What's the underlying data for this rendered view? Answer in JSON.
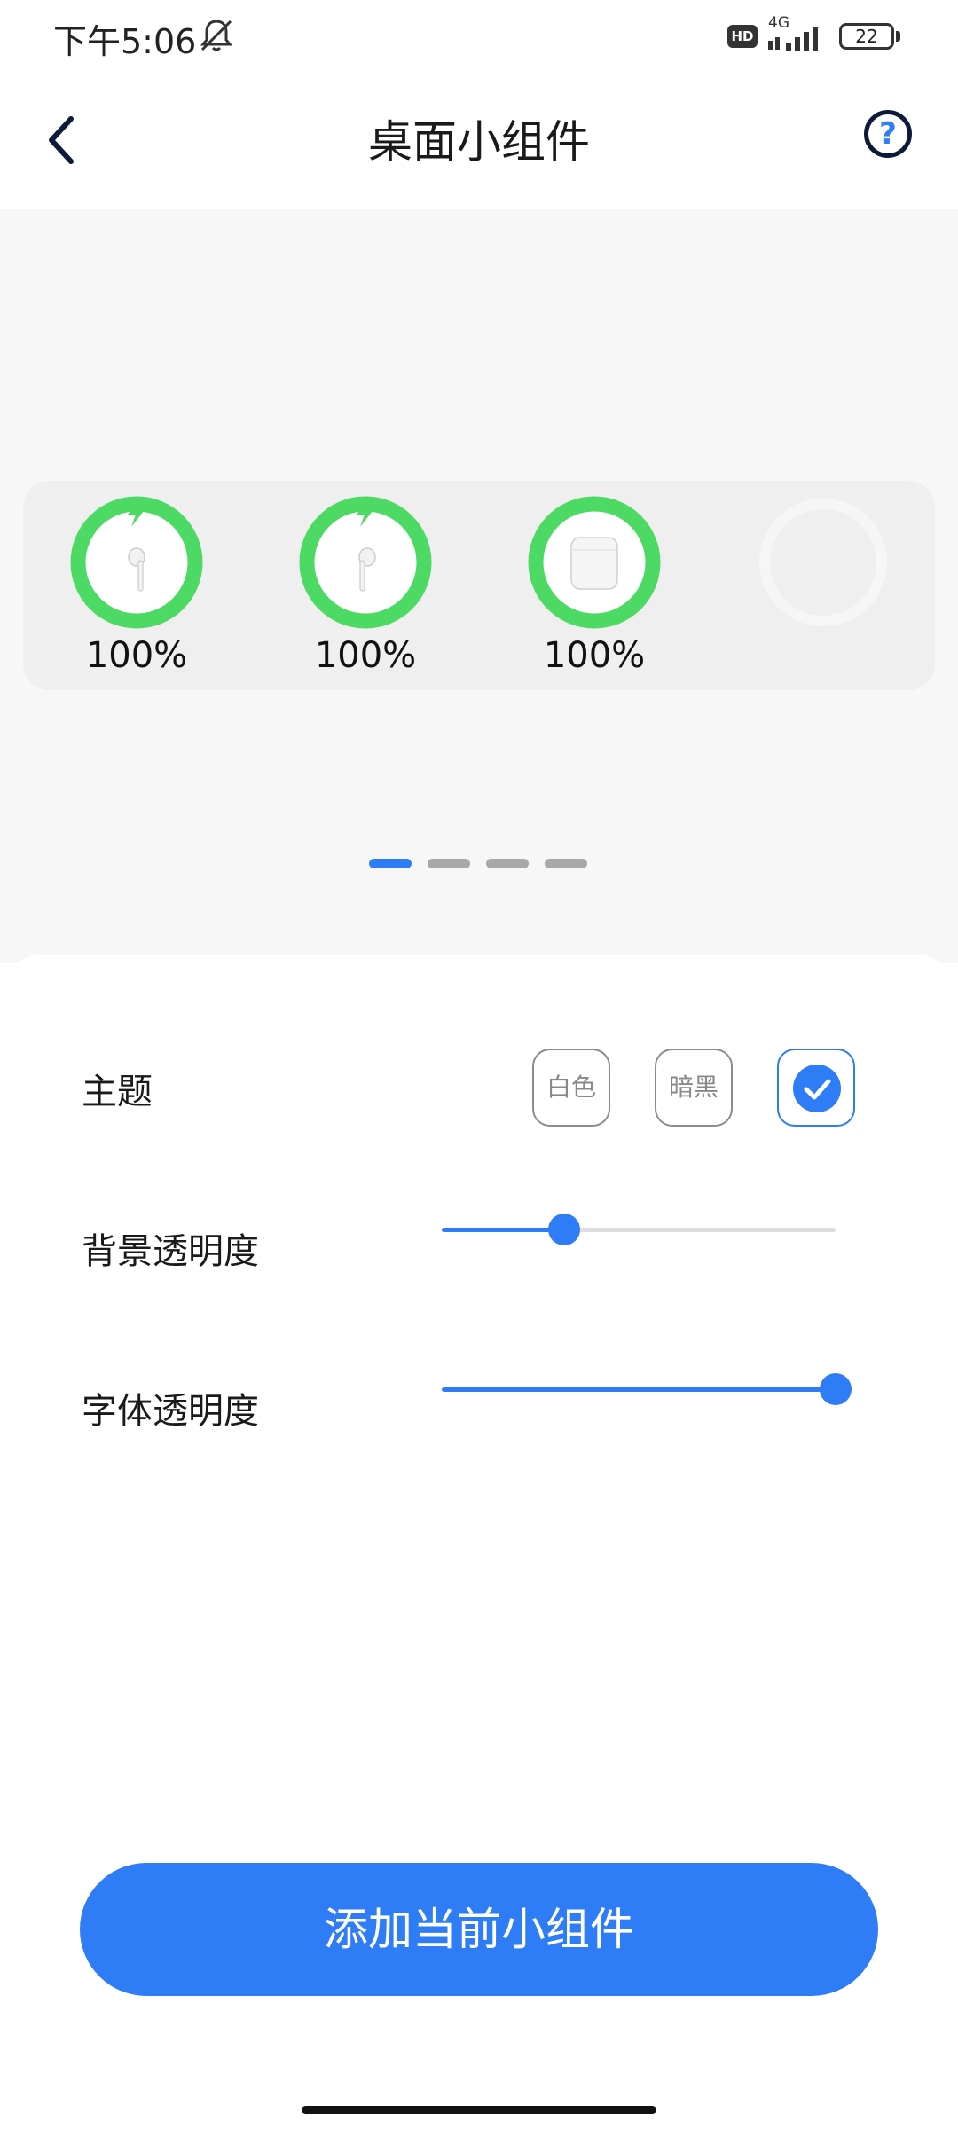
{
  "status_bar": {
    "time": "下午5:06",
    "hd": "HD",
    "network": "4G",
    "battery": "22"
  },
  "header": {
    "title": "桌面小组件",
    "help": "?"
  },
  "widget": {
    "ring_color": "#4cd964",
    "items": [
      {
        "name": "left-earbud",
        "percent": "100%",
        "level": 1.0,
        "charging": true
      },
      {
        "name": "right-earbud",
        "percent": "100%",
        "level": 1.0,
        "charging": true
      },
      {
        "name": "charging-case",
        "percent": "100%",
        "level": 1.0,
        "charging": false
      }
    ],
    "page_count": 4,
    "active_page": 1
  },
  "settings": {
    "theme_label": "主题",
    "theme_options": [
      "白色",
      "暗黑"
    ],
    "theme_selected": "custom",
    "bg_opacity_label": "背景透明度",
    "bg_opacity_value": 0.31,
    "font_opacity_label": "字体透明度",
    "font_opacity_value": 1.0
  },
  "actions": {
    "add_widget": "添加当前小组件"
  },
  "colors": {
    "accent": "#2e7cf6",
    "ring_green": "#4cd964"
  }
}
